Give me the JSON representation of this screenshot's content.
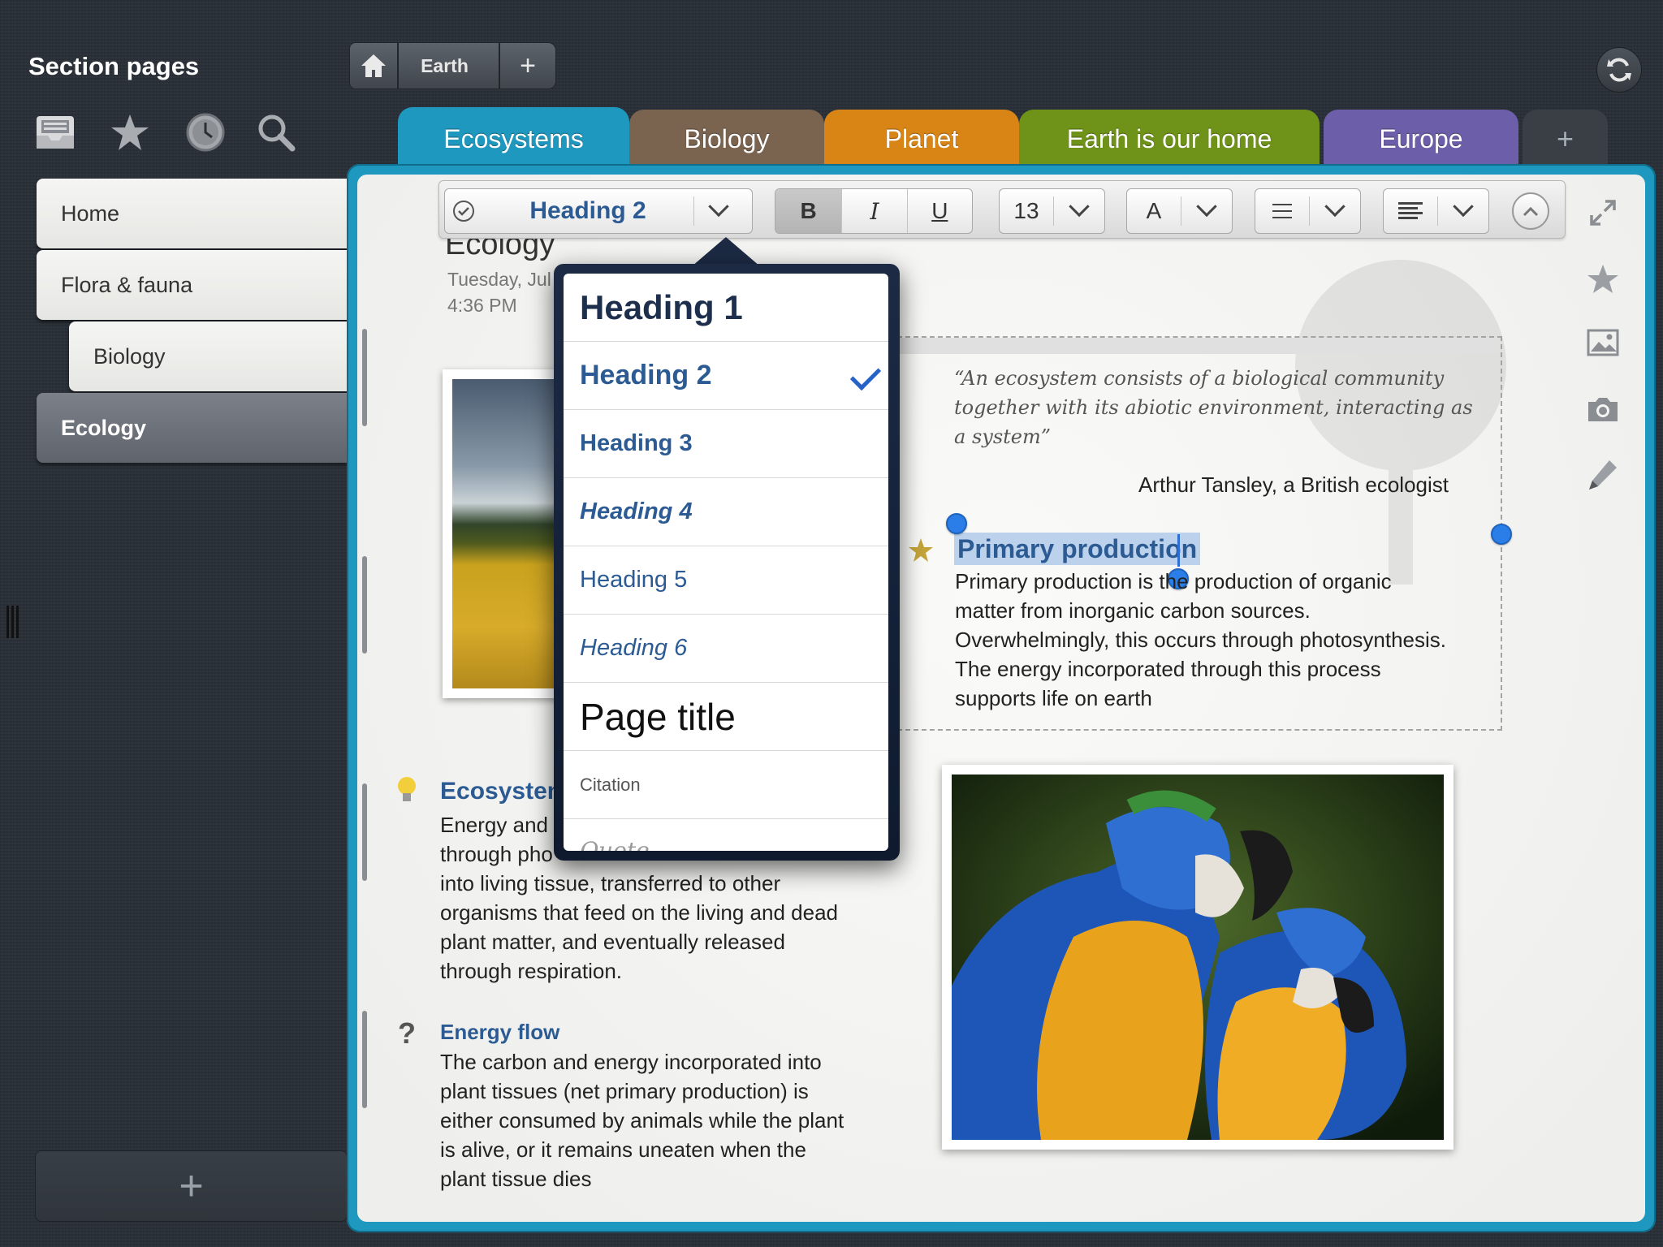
{
  "sidebar": {
    "title": "Section pages",
    "tools": [
      "inbox-icon",
      "star-icon",
      "clock-icon",
      "search-icon"
    ],
    "pages": [
      {
        "label": "Home",
        "level": 0,
        "active": false
      },
      {
        "label": "Flora & fauna",
        "level": 0,
        "active": false
      },
      {
        "label": "Biology",
        "level": 1,
        "active": false
      },
      {
        "label": "Ecology",
        "level": 0,
        "active": true
      }
    ],
    "add_label": "+"
  },
  "breadcrumb": {
    "items": [
      "Earth"
    ],
    "add_label": "+"
  },
  "tabs": [
    {
      "label": "Ecosystems",
      "color": "#1f98bf",
      "active": true
    },
    {
      "label": "Biology",
      "color": "#7a6450",
      "active": false
    },
    {
      "label": "Planet",
      "color": "#d98516",
      "active": false
    },
    {
      "label": "Earth is our home",
      "color": "#6f9319",
      "active": false
    },
    {
      "label": "Europe",
      "color": "#6c5ea8",
      "active": false
    },
    {
      "label": "+",
      "color": "#3a3f46",
      "active": false
    }
  ],
  "toolbar": {
    "style_value": "Heading 2",
    "bold": "B",
    "italic": "I",
    "underline": "U",
    "font_size": "13",
    "font_color": "A"
  },
  "page": {
    "title": "Ecology",
    "date": "Tuesday, Jul",
    "time": "4:36 PM"
  },
  "quote": {
    "text": "“An ecosystem consists of a biological community together with its abiotic environment, interacting as a system”",
    "author": "Arthur Tansley, a British ecologist"
  },
  "primary": {
    "heading": "Primary production",
    "body": "Primary production is the production of organic matter from inorganic carbon sources. Overwhelmingly, this occurs through photosynthesis. The energy incorporated through this process supports life on earth"
  },
  "ecosystem": {
    "heading": "Ecosystem",
    "body_lines": [
      "Energy and",
      "through pho",
      "into living tissue, transferred to other",
      "organisms that feed on the living and dead",
      "plant matter, and eventually released",
      "through respiration."
    ]
  },
  "energy_flow": {
    "heading": "Energy flow",
    "body_lines": [
      "The carbon and energy incorporated into",
      "plant tissues (net primary production) is",
      "either consumed by animals while the plant",
      "is alive, or it remains uneaten when the",
      "plant tissue dies"
    ]
  },
  "style_menu": {
    "items": [
      {
        "label": "Heading 1",
        "selected": false
      },
      {
        "label": "Heading 2",
        "selected": true
      },
      {
        "label": "Heading 3",
        "selected": false
      },
      {
        "label": "Heading 4",
        "selected": false
      },
      {
        "label": "Heading 5",
        "selected": false
      },
      {
        "label": "Heading 6",
        "selected": false
      },
      {
        "label": "Page title",
        "selected": false
      },
      {
        "label": "Citation",
        "selected": false
      },
      {
        "label": "Quote",
        "selected": false
      }
    ]
  },
  "right_rail": [
    "expand-icon",
    "star-icon",
    "image-icon",
    "camera-icon",
    "pencil-icon"
  ],
  "colors": {
    "accent": "#1f98bf",
    "heading_blue": "#2c5b94",
    "selection": "#bcd1ec",
    "handle": "#2b7ee8"
  }
}
